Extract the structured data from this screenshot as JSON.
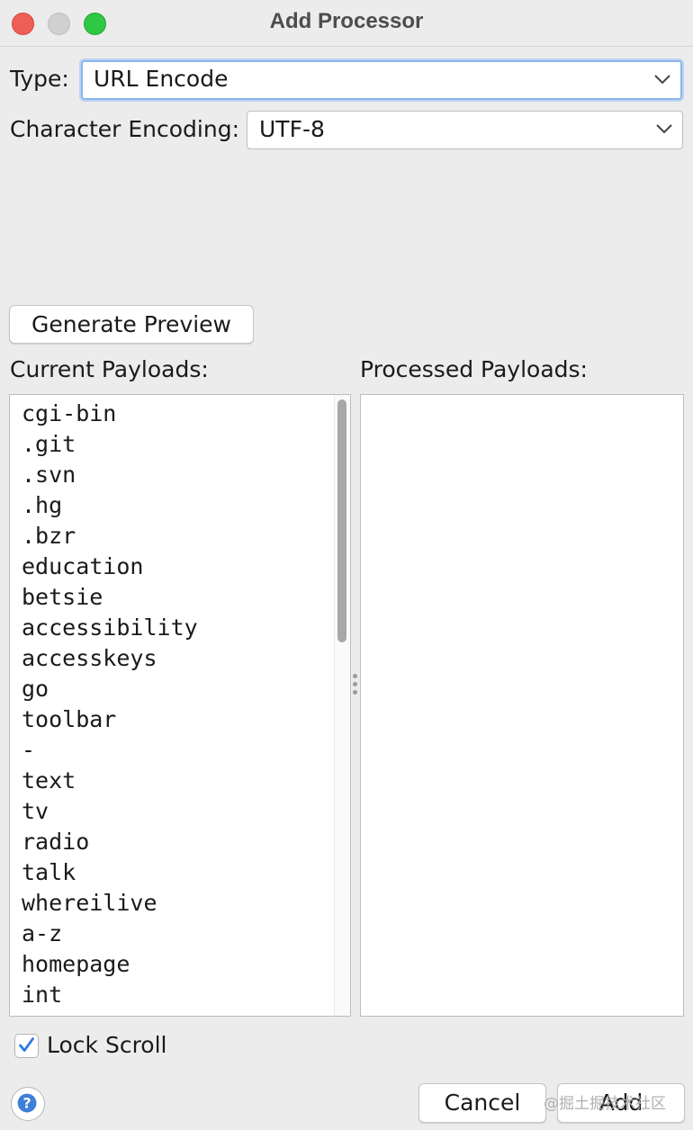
{
  "window": {
    "title": "Add Processor"
  },
  "form": {
    "type_label": "Type:",
    "type_value": "URL Encode",
    "encoding_label": "Character Encoding:",
    "encoding_value": "UTF-8"
  },
  "generate_preview_label": "Generate Preview",
  "current_payloads": {
    "label": "Current Payloads:",
    "items": [
      "cgi-bin",
      ".git",
      ".svn",
      ".hg",
      ".bzr",
      "education",
      "betsie",
      "accessibility",
      "accesskeys",
      "go",
      "toolbar",
      "-",
      "text",
      "tv",
      "radio",
      "talk",
      "whereilive",
      "a-z",
      "homepage",
      "int"
    ]
  },
  "processed_payloads": {
    "label": "Processed Payloads:",
    "items": []
  },
  "lock_scroll": {
    "label": "Lock Scroll",
    "checked": true
  },
  "footer": {
    "cancel_label": "Cancel",
    "add_label": "Add"
  },
  "watermark": "@掘土掘技术社区",
  "icons": {
    "close": "close-icon",
    "minimize": "minimize-icon",
    "maximize": "maximize-icon",
    "dropdown": "chevron-down-icon",
    "help": "help-icon",
    "check": "checkmark-icon"
  },
  "colors": {
    "close": "#ee5f57",
    "minimize": "#d0d0d0",
    "maximize": "#2ec842",
    "focus_ring": "#8fb5ec",
    "accent": "#2b78e4"
  }
}
